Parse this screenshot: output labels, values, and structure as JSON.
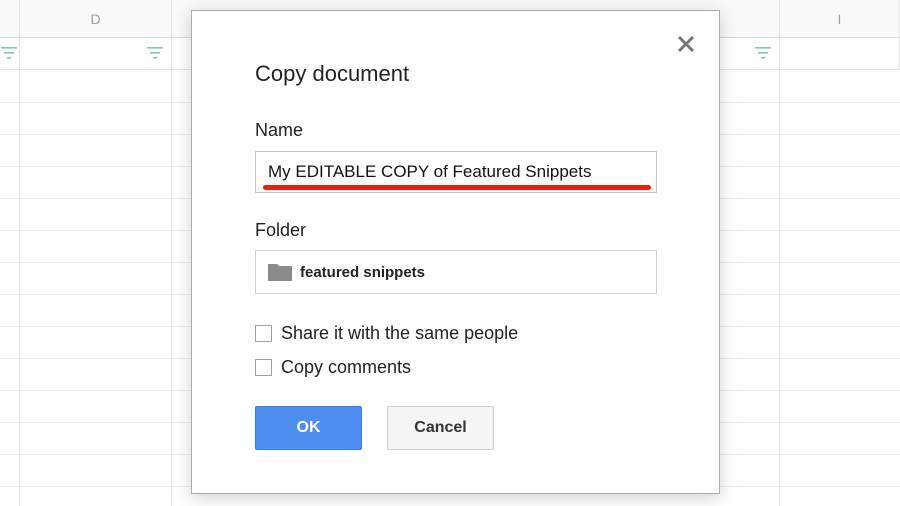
{
  "sheet": {
    "columns": [
      "D",
      "I"
    ]
  },
  "dialog": {
    "title": "Copy document",
    "name_label": "Name",
    "name_value": "My EDITABLE COPY of Featured Snippets",
    "folder_label": "Folder",
    "folder_name": "featured snippets",
    "share_label": "Share it with the same people",
    "copy_comments_label": "Copy comments",
    "ok_label": "OK",
    "cancel_label": "Cancel",
    "close_icon": "close-icon",
    "folder_icon": "folder-icon"
  },
  "colors": {
    "ok_button": "#4d8ff1",
    "highlight_underline": "#e8200f"
  }
}
